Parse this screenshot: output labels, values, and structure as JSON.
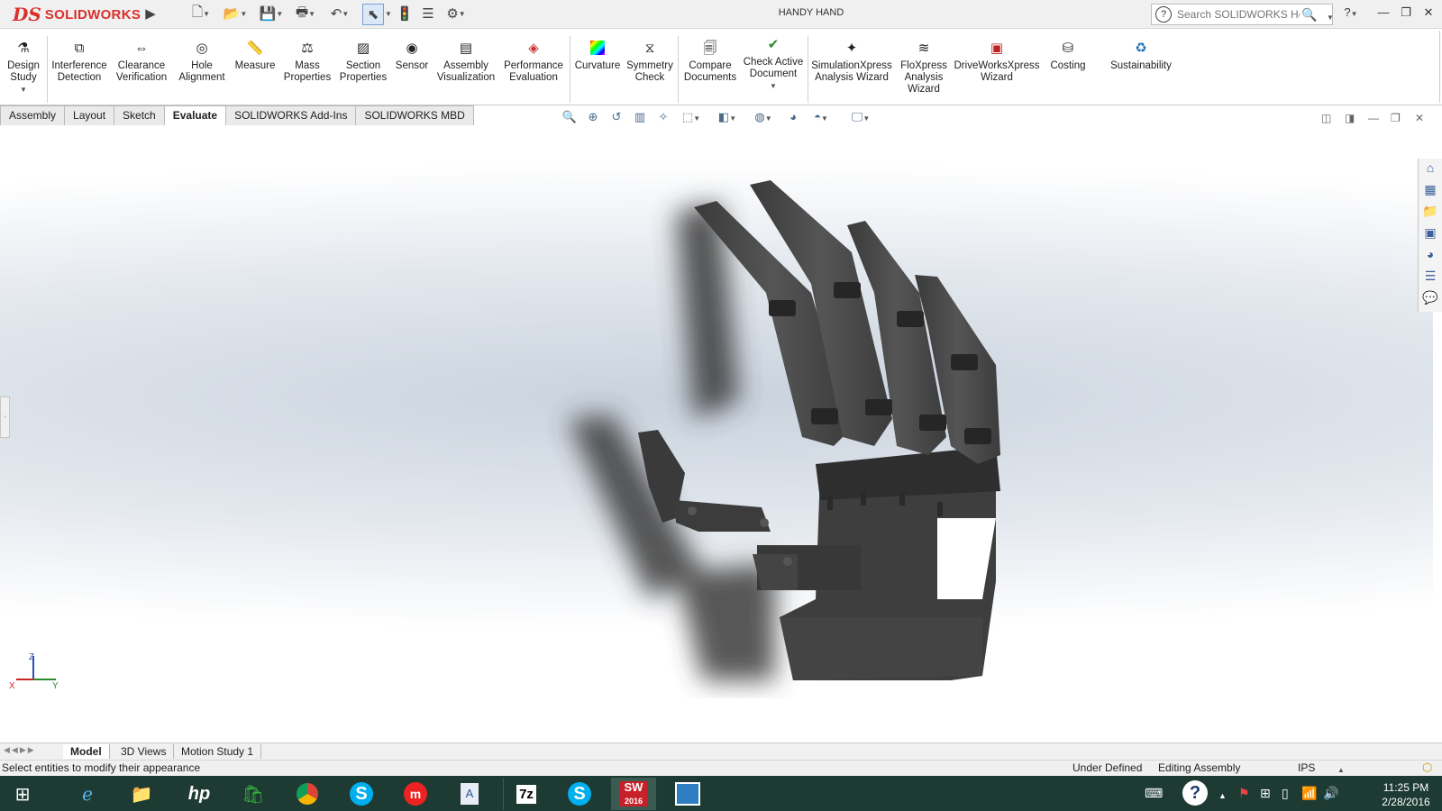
{
  "app": {
    "logo_text": "SOLIDWORKS",
    "document_title": "HANDY HAND"
  },
  "help_search": {
    "placeholder": "Search SOLIDWORKS Help"
  },
  "ribbon": {
    "items": [
      {
        "label": "Design Study",
        "icon": "design-study-icon"
      },
      {
        "label": "Interference Detection",
        "icon": "interference-icon"
      },
      {
        "label": "Clearance Verification",
        "icon": "clearance-icon"
      },
      {
        "label": "Hole Alignment",
        "icon": "hole-alignment-icon"
      },
      {
        "label": "Measure",
        "icon": "measure-icon"
      },
      {
        "label": "Mass Properties",
        "icon": "mass-properties-icon"
      },
      {
        "label": "Section Properties",
        "icon": "section-properties-icon"
      },
      {
        "label": "Sensor",
        "icon": "sensor-icon"
      },
      {
        "label": "Assembly Visualization",
        "icon": "assembly-visualization-icon"
      },
      {
        "label": "Performance Evaluation",
        "icon": "performance-icon"
      },
      {
        "label": "Curvature",
        "icon": "curvature-icon"
      },
      {
        "label": "Symmetry Check",
        "icon": "symmetry-icon"
      },
      {
        "label": "Compare Documents",
        "icon": "compare-icon"
      },
      {
        "label": "Check Active Document",
        "icon": "check-document-icon"
      },
      {
        "label": "SimulationXpress Analysis Wizard",
        "icon": "simulation-icon"
      },
      {
        "label": "FloXpress Analysis Wizard",
        "icon": "floxpress-icon"
      },
      {
        "label": "DriveWorksXpress Wizard",
        "icon": "driveworks-icon"
      },
      {
        "label": "Costing",
        "icon": "costing-icon"
      },
      {
        "label": "Sustainability",
        "icon": "sustainability-icon"
      }
    ]
  },
  "command_tabs": [
    "Assembly",
    "Layout",
    "Sketch",
    "Evaluate",
    "SOLIDWORKS Add-Ins",
    "SOLIDWORKS MBD"
  ],
  "active_command_tab": "Evaluate",
  "triad": {
    "z": "Z",
    "y": "Y",
    "x": "X"
  },
  "bottom_tabs": [
    "Model",
    "3D Views",
    "Motion Study 1"
  ],
  "active_bottom_tab": "Model",
  "status": {
    "message": "Select entities to modify their appearance",
    "definition": "Under Defined",
    "mode": "Editing Assembly",
    "units": "IPS"
  },
  "taskbar": {
    "apps": [
      "Start",
      "Internet Explorer",
      "File Explorer",
      "HP",
      "Store",
      "Chrome",
      "Skype",
      "MakerBot",
      "Word",
      "7-Zip",
      "Skype",
      "SOLIDWORKS 2016",
      "Photos"
    ],
    "sw_badge": "2016",
    "seven_zip": "7z",
    "time": "11:25 PM",
    "date": "2/28/2016"
  },
  "colors": {
    "accent_red": "#d9302c",
    "model_gray": "#4a4a4a",
    "taskbar": "#1d3b33"
  }
}
